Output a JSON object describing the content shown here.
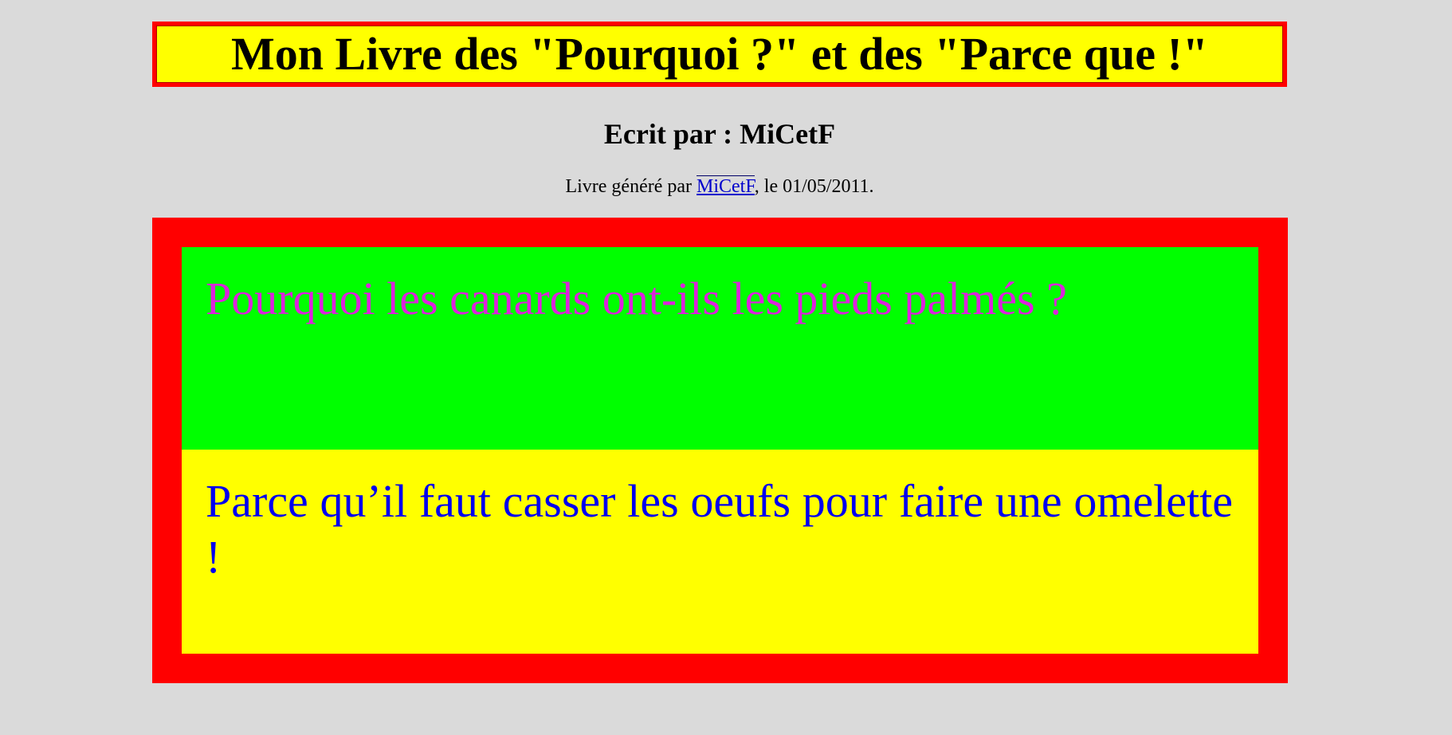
{
  "header": {
    "title": "Mon Livre des \"Pourquoi ?\" et des \"Parce que !\""
  },
  "author": {
    "text": "Ecrit par : MiCetF"
  },
  "generated": {
    "prefix": "Livre généré par ",
    "link_label": "MiCetF",
    "suffix": ", le 01/05/2011."
  },
  "card": {
    "question": "Pourquoi les canards ont-ils les pieds palmés ?",
    "answer": "Parce qu’il faut casser les oeufs pour faire une omelette !"
  },
  "colors": {
    "page_background": "#dadada",
    "title_background": "#ffff00",
    "frame": "#ff0000",
    "question_background": "#00ff00",
    "question_text": "#dd22dd",
    "answer_background": "#ffff00",
    "answer_text": "#0000ee"
  }
}
